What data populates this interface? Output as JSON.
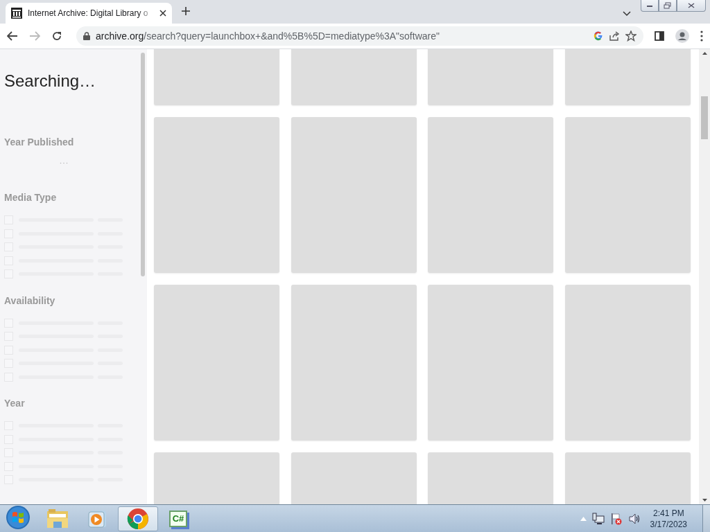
{
  "browser": {
    "tabs": [
      {
        "title": "Internet Archive: Digital Library o",
        "selected": true
      }
    ],
    "address": {
      "host": "archive.org",
      "path": "/search?query=launchbox+&and%5B%5D=mediatype%3A\"software\""
    }
  },
  "sidebar": {
    "heading": "Searching…",
    "facets": [
      {
        "title": "Year Published",
        "kind": "histogram"
      },
      {
        "title": "Media Type",
        "kind": "checklist",
        "options": [
          {
            "checked": false
          },
          {
            "checked": false
          },
          {
            "checked": false
          },
          {
            "checked": false
          },
          {
            "checked": false
          }
        ]
      },
      {
        "title": "Availability",
        "kind": "checklist",
        "options": [
          {
            "checked": false
          },
          {
            "checked": false
          },
          {
            "checked": false
          },
          {
            "checked": false
          },
          {
            "checked": false
          }
        ]
      },
      {
        "title": "Year",
        "kind": "checklist",
        "options": [
          {
            "checked": false
          },
          {
            "checked": false
          },
          {
            "checked": false
          },
          {
            "checked": false
          },
          {
            "checked": false
          }
        ]
      }
    ]
  },
  "taskbar": {
    "apps": [
      {
        "kind": "explorer",
        "selected": false
      },
      {
        "kind": "media",
        "selected": false
      },
      {
        "kind": "chrome",
        "selected": true
      },
      {
        "kind": "csharp",
        "label": "C#",
        "selected": false
      }
    ],
    "clock": {
      "time": "2:41 PM",
      "date": "3/17/2023"
    }
  }
}
